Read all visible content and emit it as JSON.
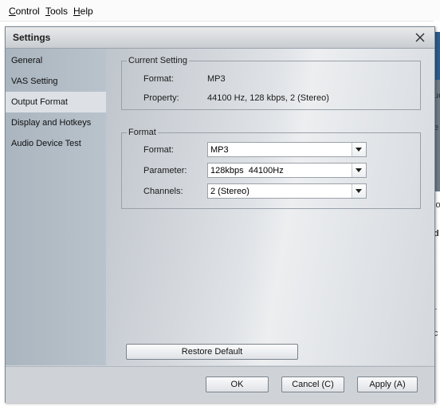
{
  "menubar": {
    "items": [
      "Control",
      "Tools",
      "Help"
    ]
  },
  "background_edge": {
    "tag1": "ue",
    "tag2": "e",
    "tag3": "lo",
    "tag4": "d",
    "tag5": "r",
    "tag6": "c"
  },
  "dialog": {
    "title": "Settings",
    "nav": [
      {
        "label": "General"
      },
      {
        "label": "VAS Setting"
      },
      {
        "label": "Output Format"
      },
      {
        "label": "Display and Hotkeys"
      },
      {
        "label": "Audio Device Test"
      }
    ],
    "active_nav": "Output Format",
    "current_setting": {
      "legend": "Current Setting",
      "format_label": "Format:",
      "format_value": "MP3",
      "property_label": "Property:",
      "property_value": "44100 Hz, 128 kbps, 2 (Stereo)"
    },
    "format_group": {
      "legend": "Format",
      "format_label": "Format:",
      "format_value": "MP3",
      "parameter_label": "Parameter:",
      "parameter_value": "128kbps  44100Hz",
      "channels_label": "Channels:",
      "channels_value": "2 (Stereo)"
    },
    "restore_default": "Restore Default",
    "buttons": {
      "ok": "OK",
      "cancel": "Cancel (C)",
      "apply": "Apply (A)"
    }
  },
  "colors": {
    "sidebar": "#b2bcc6",
    "active_nav": "#dde1e6",
    "dialog_bg": "#cfd3d8"
  }
}
